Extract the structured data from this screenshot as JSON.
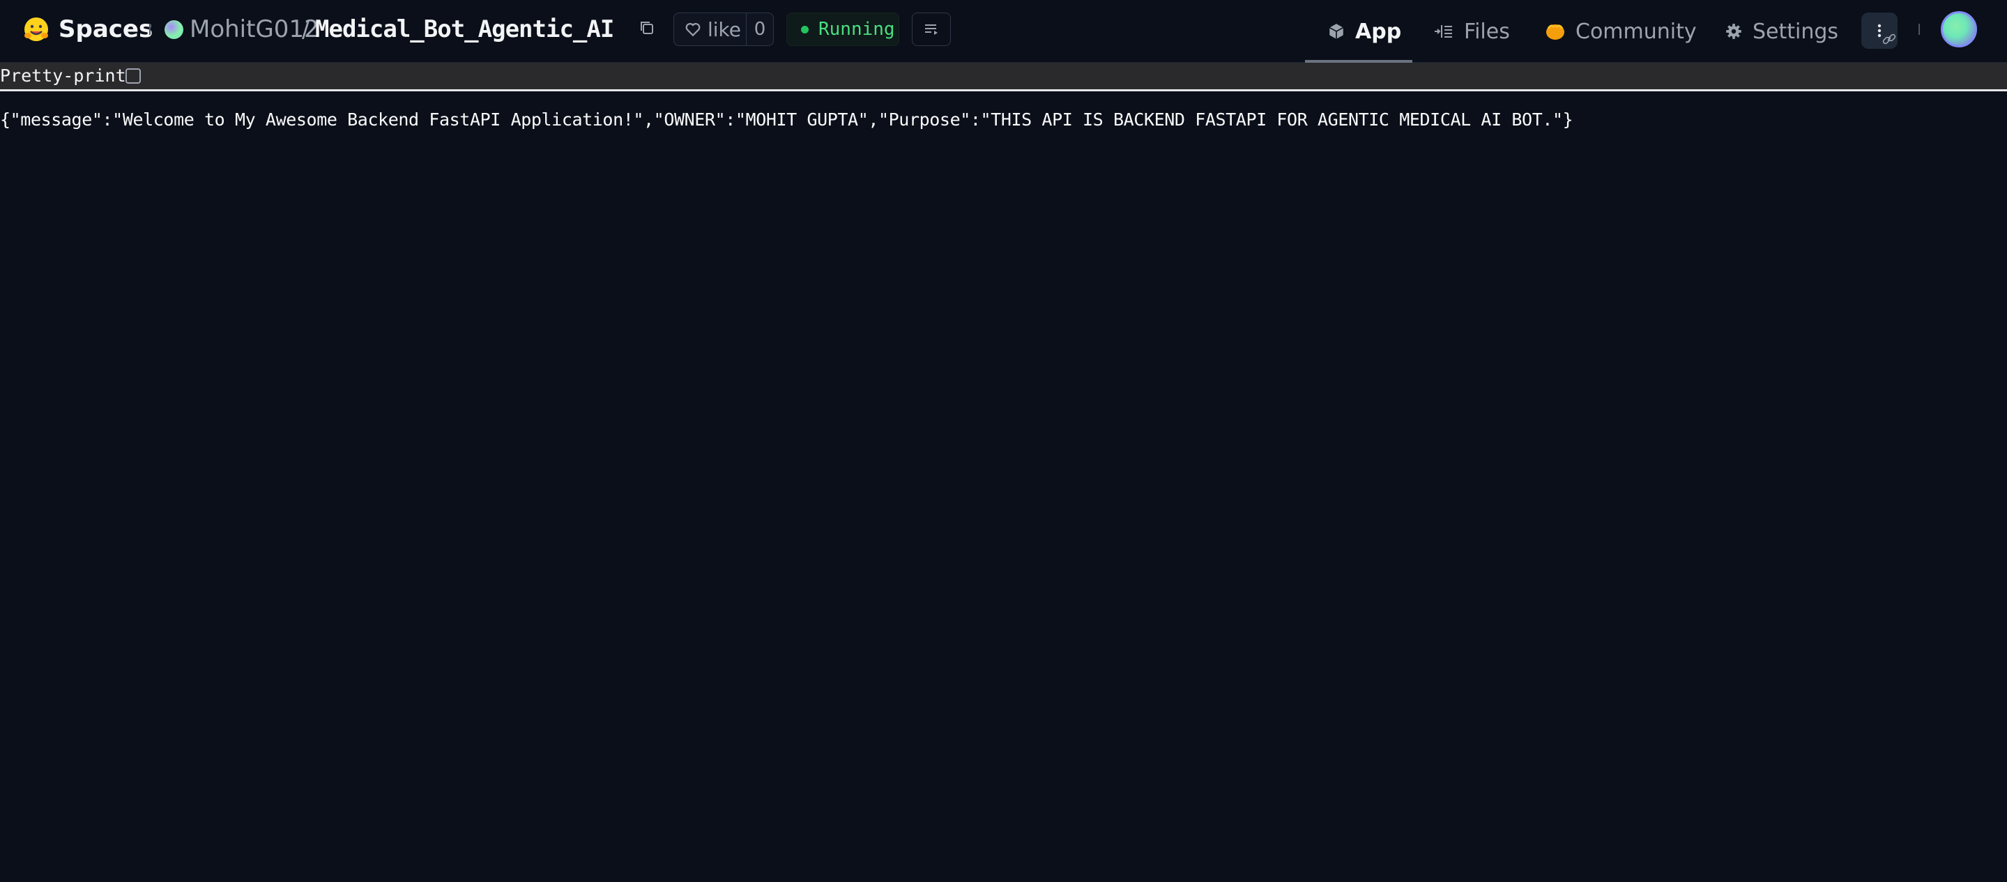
{
  "header": {
    "brand_label": "Spaces",
    "owner": "MohitG012",
    "separator": "/",
    "repo": "Medical_Bot_Agentic_AI",
    "like_label": "like",
    "like_count": "0",
    "status": "Running",
    "status_color": "#4ade80",
    "tabs": [
      {
        "label": "App",
        "icon": "cube-icon",
        "active": true
      },
      {
        "label": "Files",
        "icon": "files-icon",
        "active": false
      },
      {
        "label": "Community",
        "icon": "community-icon",
        "active": false
      },
      {
        "label": "Settings",
        "icon": "gear-icon",
        "active": false
      }
    ]
  },
  "viewer": {
    "pretty_print_label": "Pretty-print",
    "pretty_print_checked": false,
    "raw_json": "{\"message\":\"Welcome to My Awesome Backend FastAPI Application!\",\"OWNER\":\"MOHIT GUPTA\",\"Purpose\":\"THIS API IS BACKEND FASTAPI FOR AGENTIC MEDICAL AI BOT.\"}"
  },
  "colors": {
    "background": "#0b0f19",
    "accent_running": "#22c55e"
  }
}
